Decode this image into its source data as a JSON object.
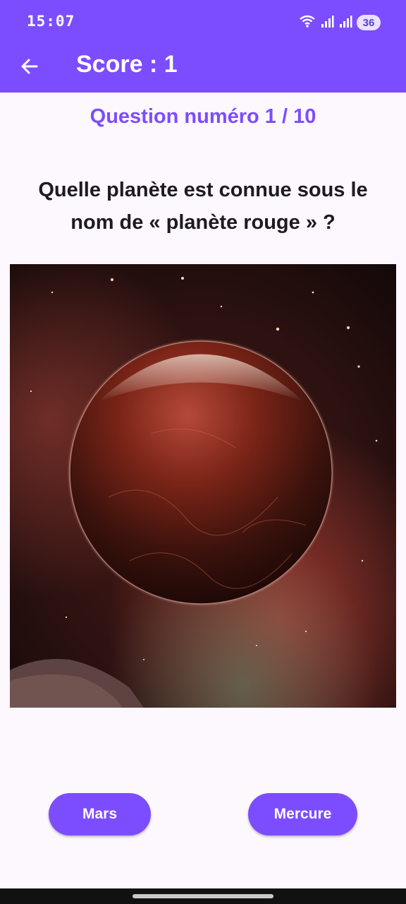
{
  "status_bar": {
    "time": "15:07",
    "battery": "36",
    "icons": [
      "wifi-icon",
      "signal-icon",
      "signal-icon",
      "battery-icon"
    ]
  },
  "app_bar": {
    "back_icon": "arrow-back-icon",
    "title": "Score : 1"
  },
  "question": {
    "number_label": "Question numéro 1 / 10",
    "text": "Quelle planète est connue sous le nom de « planète rouge » ?",
    "image": "red-planet-image"
  },
  "answers": [
    {
      "label": "Mars"
    },
    {
      "label": "Mercure"
    }
  ],
  "colors": {
    "primary": "#7c4dff",
    "background": "#fdf7fe",
    "text": "#1d1b20"
  }
}
